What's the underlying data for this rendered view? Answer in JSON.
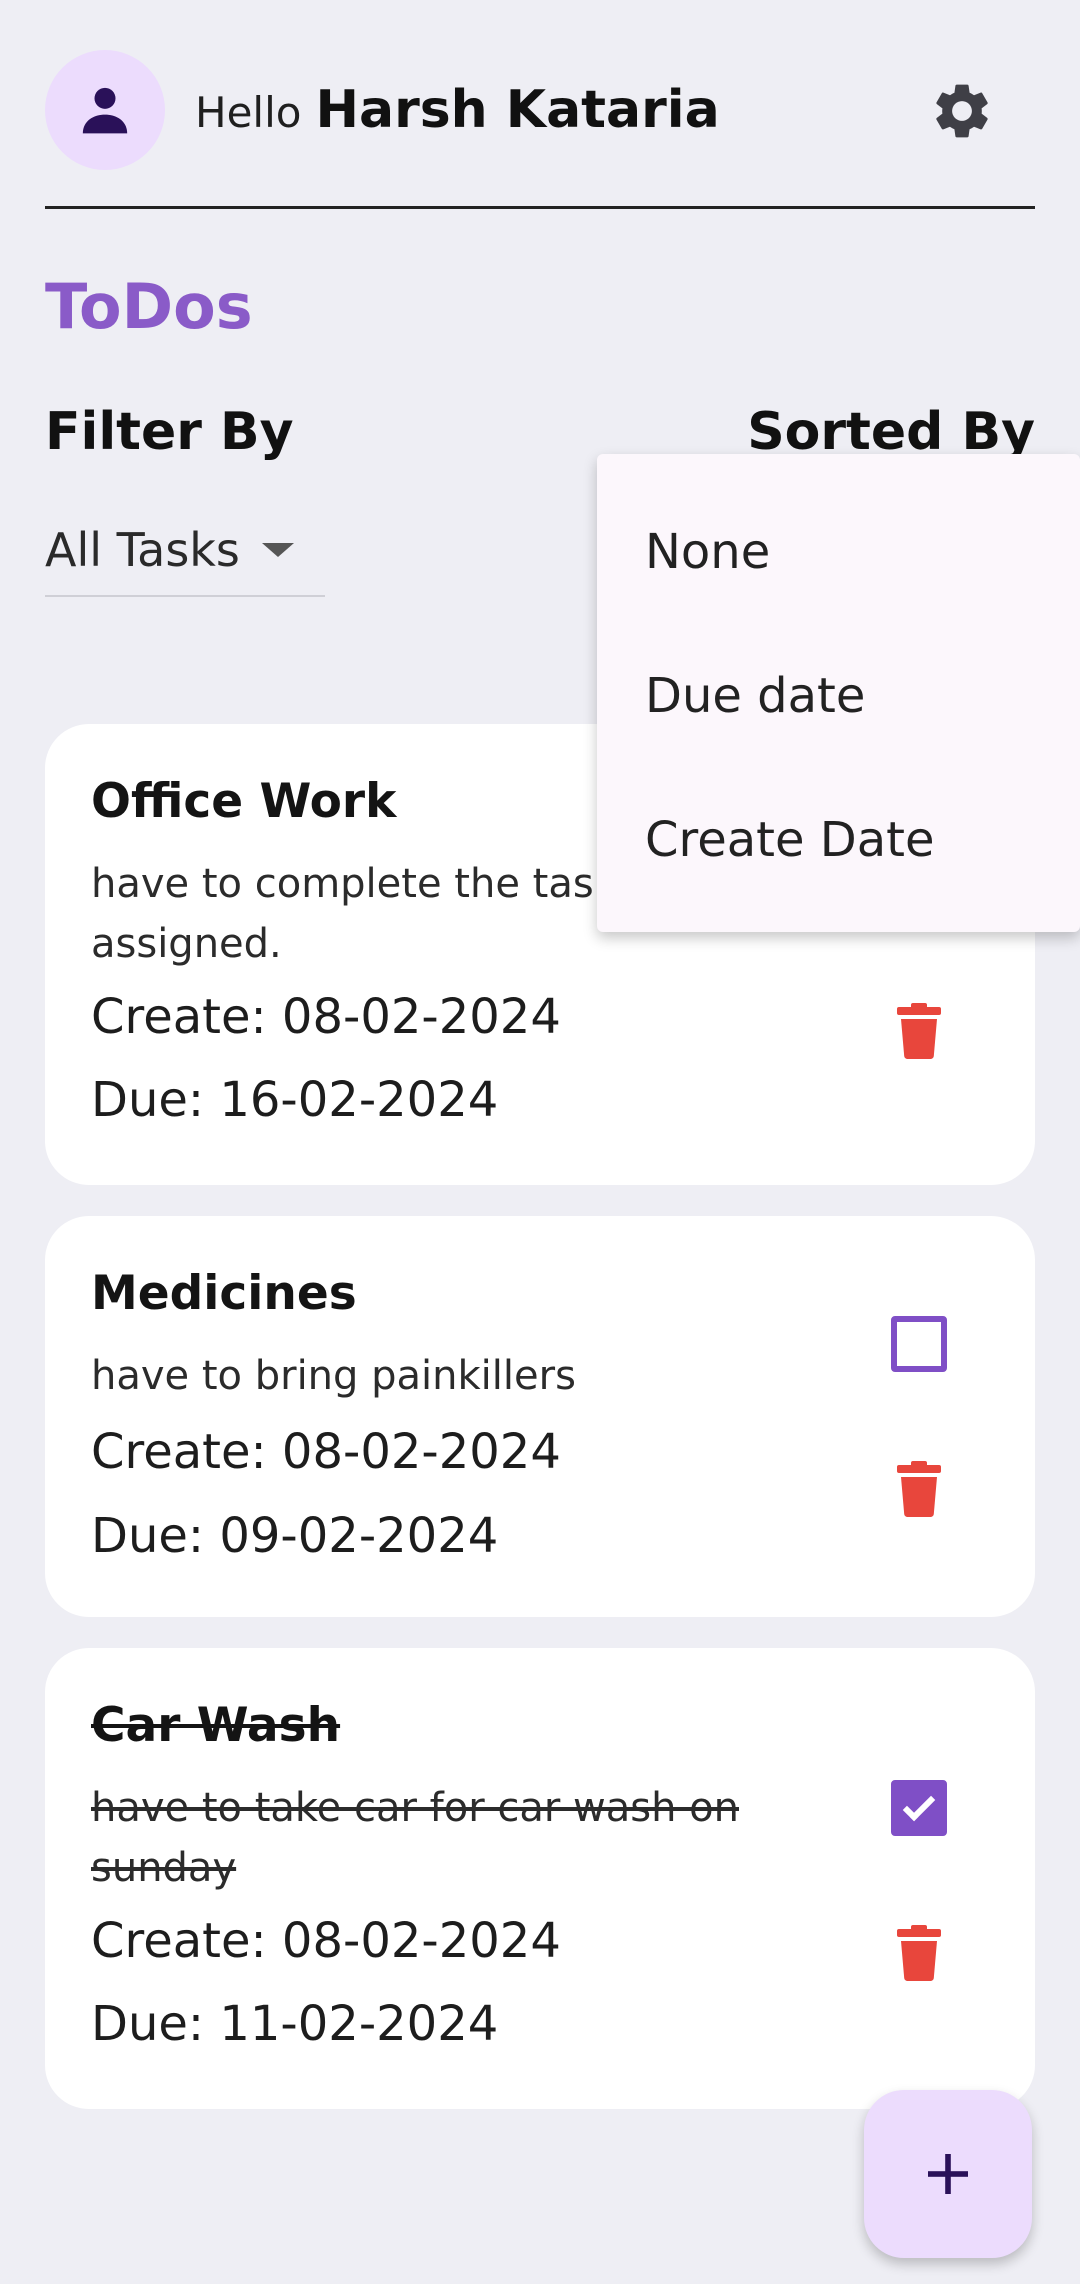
{
  "header": {
    "greeting": "Hello",
    "user_name": "Harsh Kataria",
    "avatar_icon": "person-icon",
    "settings_icon": "gear-icon"
  },
  "page_title": "ToDos",
  "filter": {
    "label": "Filter By",
    "selected": "All Tasks"
  },
  "sort": {
    "label": "Sorted By",
    "options": [
      "None",
      "Due date",
      "Create Date"
    ]
  },
  "todos": [
    {
      "title": "Office Work",
      "description": "have to complete the tasks assigned.",
      "create": "Create: 08-02-2024",
      "due": "Due: 16-02-2024",
      "completed": false
    },
    {
      "title": "Medicines",
      "description": "have to bring painkillers",
      "create": "Create: 08-02-2024",
      "due": "Due: 09-02-2024",
      "completed": false
    },
    {
      "title": "Car Wash",
      "description": "have to take car for car wash on sunday",
      "create": "Create: 08-02-2024",
      "due": "Due: 11-02-2024",
      "completed": true
    }
  ],
  "fab_icon": "plus-icon",
  "colors": {
    "accent": "#8a5bc8",
    "checkbox": "#7f4fc6",
    "delete": "#e8463c",
    "avatar_bg": "#ecdcfd"
  }
}
